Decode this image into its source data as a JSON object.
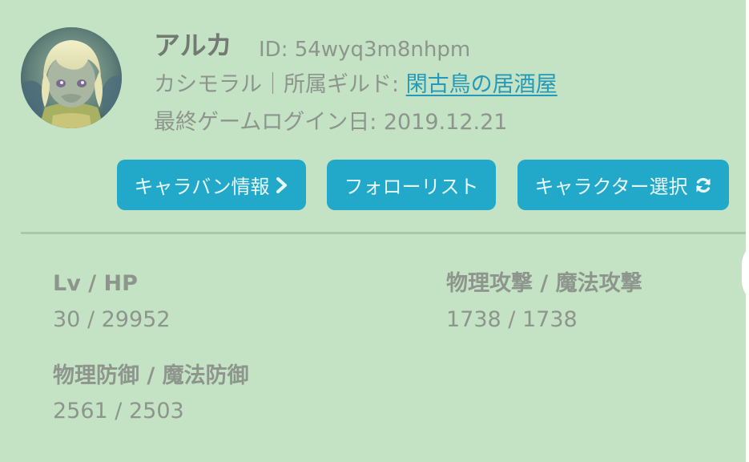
{
  "profile": {
    "name": "アルカ",
    "id_text": "ID: 54wyq3m8nhpm",
    "class_name": "カシモラル",
    "separator": "｜",
    "guild_label": "所属ギルド: ",
    "guild_name": "閑古鳥の居酒屋",
    "last_login_label": "最終ゲームログイン日: ",
    "last_login_date": "2019.12.21"
  },
  "buttons": {
    "caravan": "キャラバン情報",
    "follow": "フォローリスト",
    "character_select": "キャラクター選択"
  },
  "icons": {
    "caravan": "chevron-right-icon",
    "character_select": "refresh-icon"
  },
  "stats": [
    {
      "label": "Lv / HP",
      "value": "30 / 29952"
    },
    {
      "label": "物理攻撃 / 魔法攻撃",
      "value": "1738 / 1738"
    },
    {
      "label": "物理防御 / 魔法防御",
      "value": "2561 / 2503"
    }
  ],
  "colors": {
    "background": "#c3e3c4",
    "button": "#22a9c9",
    "link": "#2599b9",
    "text": "#8d958d"
  }
}
